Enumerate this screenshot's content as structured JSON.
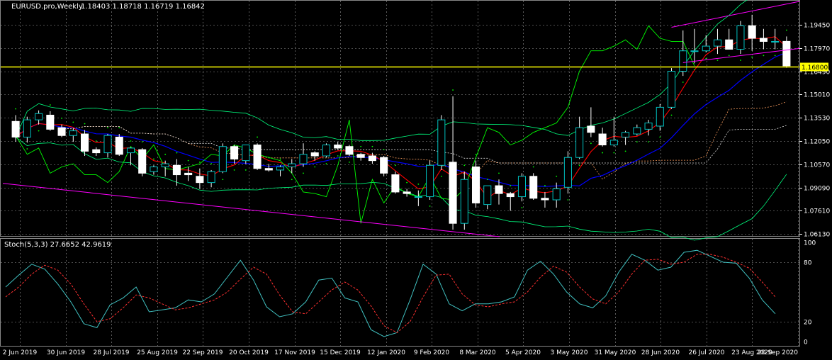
{
  "chart_data": [
    {
      "type": "candlestick",
      "title": "EURUSD.pro,Weekly",
      "ohlc_label": "1.18403 1.18718 1.16719 1.16842",
      "y_ticks": [
        "1.19450",
        "1.17970",
        "1.16490",
        "1.15010",
        "1.13530",
        "1.12050",
        "1.10570",
        "1.09090",
        "1.07610",
        "1.06130"
      ],
      "ylim": [
        1.0595,
        1.2095
      ],
      "current_price_label": "1.16800",
      "current_price": 1.168,
      "x_tick_labels": [
        "2 Jun 2019",
        "30 Jun 2019",
        "28 Jul 2019",
        "25 Aug 2019",
        "22 Sep 2019",
        "20 Oct 2019",
        "17 Nov 2019",
        "15 Dec 2019",
        "12 Jan 2020",
        "9 Feb 2020",
        "8 Mar 2020",
        "5 Apr 2020",
        "3 May 2020",
        "31 May 2020",
        "28 Jun 2020",
        "26 Jul 2020",
        "23 Aug 2020",
        "20 Sep 2020"
      ],
      "candles": [
        {
          "o": 1.133,
          "h": 1.137,
          "l": 1.12,
          "c": 1.123
        },
        {
          "o": 1.123,
          "h": 1.136,
          "l": 1.1195,
          "c": 1.134
        },
        {
          "o": 1.134,
          "h": 1.14,
          "l": 1.131,
          "c": 1.138
        },
        {
          "o": 1.137,
          "h": 1.1395,
          "l": 1.127,
          "c": 1.128
        },
        {
          "o": 1.129,
          "h": 1.131,
          "l": 1.123,
          "c": 1.124
        },
        {
          "o": 1.124,
          "h": 1.1285,
          "l": 1.12,
          "c": 1.127
        },
        {
          "o": 1.125,
          "h": 1.1275,
          "l": 1.111,
          "c": 1.114
        },
        {
          "o": 1.115,
          "h": 1.1165,
          "l": 1.111,
          "c": 1.113
        },
        {
          "o": 1.113,
          "h": 1.125,
          "l": 1.11,
          "c": 1.124
        },
        {
          "o": 1.123,
          "h": 1.125,
          "l": 1.111,
          "c": 1.112
        },
        {
          "o": 1.113,
          "h": 1.1165,
          "l": 1.105,
          "c": 1.116
        },
        {
          "o": 1.115,
          "h": 1.116,
          "l": 1.098,
          "c": 1.1
        },
        {
          "o": 1.101,
          "h": 1.105,
          "l": 1.099,
          "c": 1.104
        },
        {
          "o": 1.104,
          "h": 1.108,
          "l": 1.098,
          "c": 1.106
        },
        {
          "o": 1.105,
          "h": 1.109,
          "l": 1.092,
          "c": 1.099
        },
        {
          "o": 1.1,
          "h": 1.104,
          "l": 1.095,
          "c": 1.099
        },
        {
          "o": 1.098,
          "h": 1.103,
          "l": 1.09,
          "c": 1.094
        },
        {
          "o": 1.094,
          "h": 1.102,
          "l": 1.091,
          "c": 1.101
        },
        {
          "o": 1.101,
          "h": 1.119,
          "l": 1.1,
          "c": 1.117
        },
        {
          "o": 1.117,
          "h": 1.118,
          "l": 1.106,
          "c": 1.109
        },
        {
          "o": 1.108,
          "h": 1.118,
          "l": 1.106,
          "c": 1.118
        },
        {
          "o": 1.118,
          "h": 1.119,
          "l": 1.102,
          "c": 1.103
        },
        {
          "o": 1.103,
          "h": 1.106,
          "l": 1.101,
          "c": 1.102
        },
        {
          "o": 1.102,
          "h": 1.105,
          "l": 1.098,
          "c": 1.104
        },
        {
          "o": 1.104,
          "h": 1.109,
          "l": 1.1,
          "c": 1.106
        },
        {
          "o": 1.106,
          "h": 1.119,
          "l": 1.104,
          "c": 1.112
        },
        {
          "o": 1.113,
          "h": 1.114,
          "l": 1.108,
          "c": 1.111
        },
        {
          "o": 1.111,
          "h": 1.119,
          "l": 1.11,
          "c": 1.118
        },
        {
          "o": 1.118,
          "h": 1.12,
          "l": 1.115,
          "c": 1.116
        },
        {
          "o": 1.117,
          "h": 1.118,
          "l": 1.111,
          "c": 1.112
        },
        {
          "o": 1.112,
          "h": 1.113,
          "l": 1.108,
          "c": 1.11
        },
        {
          "o": 1.111,
          "h": 1.113,
          "l": 1.106,
          "c": 1.108
        },
        {
          "o": 1.11,
          "h": 1.111,
          "l": 1.098,
          "c": 1.1
        },
        {
          "o": 1.099,
          "h": 1.101,
          "l": 1.087,
          "c": 1.088
        },
        {
          "o": 1.088,
          "h": 1.09,
          "l": 1.085,
          "c": 1.087
        },
        {
          "o": 1.085,
          "h": 1.089,
          "l": 1.079,
          "c": 1.085
        },
        {
          "o": 1.085,
          "h": 1.108,
          "l": 1.083,
          "c": 1.105
        },
        {
          "o": 1.105,
          "h": 1.137,
          "l": 1.102,
          "c": 1.134
        },
        {
          "o": 1.107,
          "h": 1.149,
          "l": 1.064,
          "c": 1.068
        },
        {
          "o": 1.068,
          "h": 1.101,
          "l": 1.064,
          "c": 1.096
        },
        {
          "o": 1.104,
          "h": 1.108,
          "l": 1.078,
          "c": 1.081
        },
        {
          "o": 1.08,
          "h": 1.092,
          "l": 1.077,
          "c": 1.092
        },
        {
          "o": 1.092,
          "h": 1.096,
          "l": 1.08,
          "c": 1.087
        },
        {
          "o": 1.087,
          "h": 1.088,
          "l": 1.076,
          "c": 1.085
        },
        {
          "o": 1.085,
          "h": 1.1,
          "l": 1.082,
          "c": 1.098
        },
        {
          "o": 1.098,
          "h": 1.1,
          "l": 1.083,
          "c": 1.084
        },
        {
          "o": 1.084,
          "h": 1.088,
          "l": 1.078,
          "c": 1.083
        },
        {
          "o": 1.083,
          "h": 1.094,
          "l": 1.078,
          "c": 1.09
        },
        {
          "o": 1.091,
          "h": 1.114,
          "l": 1.087,
          "c": 1.11
        },
        {
          "o": 1.11,
          "h": 1.136,
          "l": 1.109,
          "c": 1.129
        },
        {
          "o": 1.13,
          "h": 1.142,
          "l": 1.123,
          "c": 1.126
        },
        {
          "o": 1.125,
          "h": 1.129,
          "l": 1.117,
          "c": 1.118
        },
        {
          "o": 1.118,
          "h": 1.136,
          "l": 1.117,
          "c": 1.121
        },
        {
          "o": 1.123,
          "h": 1.127,
          "l": 1.118,
          "c": 1.126
        },
        {
          "o": 1.125,
          "h": 1.131,
          "l": 1.124,
          "c": 1.129
        },
        {
          "o": 1.128,
          "h": 1.134,
          "l": 1.124,
          "c": 1.132
        },
        {
          "o": 1.13,
          "h": 1.144,
          "l": 1.127,
          "c": 1.142
        },
        {
          "o": 1.142,
          "h": 1.167,
          "l": 1.141,
          "c": 1.165
        },
        {
          "o": 1.165,
          "h": 1.191,
          "l": 1.162,
          "c": 1.178
        },
        {
          "o": 1.178,
          "h": 1.192,
          "l": 1.17,
          "c": 1.178
        },
        {
          "o": 1.178,
          "h": 1.188,
          "l": 1.177,
          "c": 1.181
        },
        {
          "o": 1.181,
          "h": 1.192,
          "l": 1.176,
          "c": 1.185
        },
        {
          "o": 1.185,
          "h": 1.192,
          "l": 1.179,
          "c": 1.179
        },
        {
          "o": 1.179,
          "h": 1.197,
          "l": 1.176,
          "c": 1.194
        },
        {
          "o": 1.194,
          "h": 1.201,
          "l": 1.178,
          "c": 1.186
        },
        {
          "o": 1.186,
          "h": 1.192,
          "l": 1.179,
          "c": 1.184
        },
        {
          "o": 1.184,
          "h": 1.192,
          "l": 1.179,
          "c": 1.184
        },
        {
          "o": 1.18403,
          "h": 1.18718,
          "l": 1.16719,
          "c": 1.16842
        }
      ],
      "colors": {
        "bull": "#000000",
        "bear": "#ffffff",
        "wick": "#ffffff",
        "price_line": "#ffff00",
        "ma_red": "#ff0000",
        "ma_blue": "#0000ff",
        "ma_green": "#00ff00",
        "bands": "#00ff7f",
        "trend": "#ff00ff"
      }
    },
    {
      "type": "line",
      "title": "Stoch(5,3,3) 27.6652 42.9619",
      "y_ticks": [
        "100",
        "80",
        "20",
        "0"
      ],
      "ylim": [
        0,
        100
      ],
      "series": [
        {
          "values": [
            55,
            67,
            78,
            73,
            58,
            40,
            18,
            14,
            37,
            44,
            55,
            30,
            32,
            34,
            42,
            40,
            48,
            65,
            82,
            62,
            35,
            25,
            28,
            40,
            62,
            64,
            44,
            40,
            12,
            5,
            9,
            42,
            78,
            68,
            38,
            31,
            38,
            38,
            40,
            45,
            72,
            81,
            68,
            50,
            38,
            34,
            46,
            70,
            88,
            82,
            72,
            75,
            90,
            92,
            86,
            80,
            79,
            64,
            42,
            28
          ]
        },
        {
          "values": [
            45,
            55,
            68,
            77,
            72,
            58,
            38,
            20,
            23,
            34,
            47,
            44,
            38,
            32,
            34,
            38,
            42,
            50,
            63,
            75,
            68,
            47,
            30,
            28,
            40,
            52,
            60,
            52,
            36,
            16,
            9,
            20,
            45,
            67,
            68,
            48,
            37,
            35,
            38,
            40,
            50,
            65,
            76,
            70,
            55,
            43,
            38,
            50,
            68,
            82,
            83,
            78,
            80,
            88,
            88,
            85,
            80,
            74,
            60,
            45
          ]
        }
      ]
    }
  ]
}
